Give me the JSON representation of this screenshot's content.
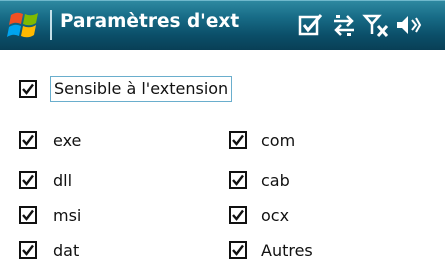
{
  "window": {
    "title": "Paramètres d'ext",
    "status_icons": [
      "checkbox-status-icon",
      "data-connection-icon",
      "no-signal-icon",
      "speaker-icon"
    ]
  },
  "main_option": {
    "label": "Sensible à l'extension",
    "checked": true
  },
  "extensions": {
    "left": [
      {
        "label": "exe",
        "checked": true
      },
      {
        "label": "dll",
        "checked": true
      },
      {
        "label": "msi",
        "checked": true
      },
      {
        "label": "dat",
        "checked": true
      }
    ],
    "right": [
      {
        "label": "com",
        "checked": true
      },
      {
        "label": "cab",
        "checked": true
      },
      {
        "label": "ocx",
        "checked": true
      },
      {
        "label": "Autres",
        "checked": true
      }
    ]
  },
  "colors": {
    "titlebar": "#0b4f69",
    "focus_border": "#6aaecd"
  }
}
